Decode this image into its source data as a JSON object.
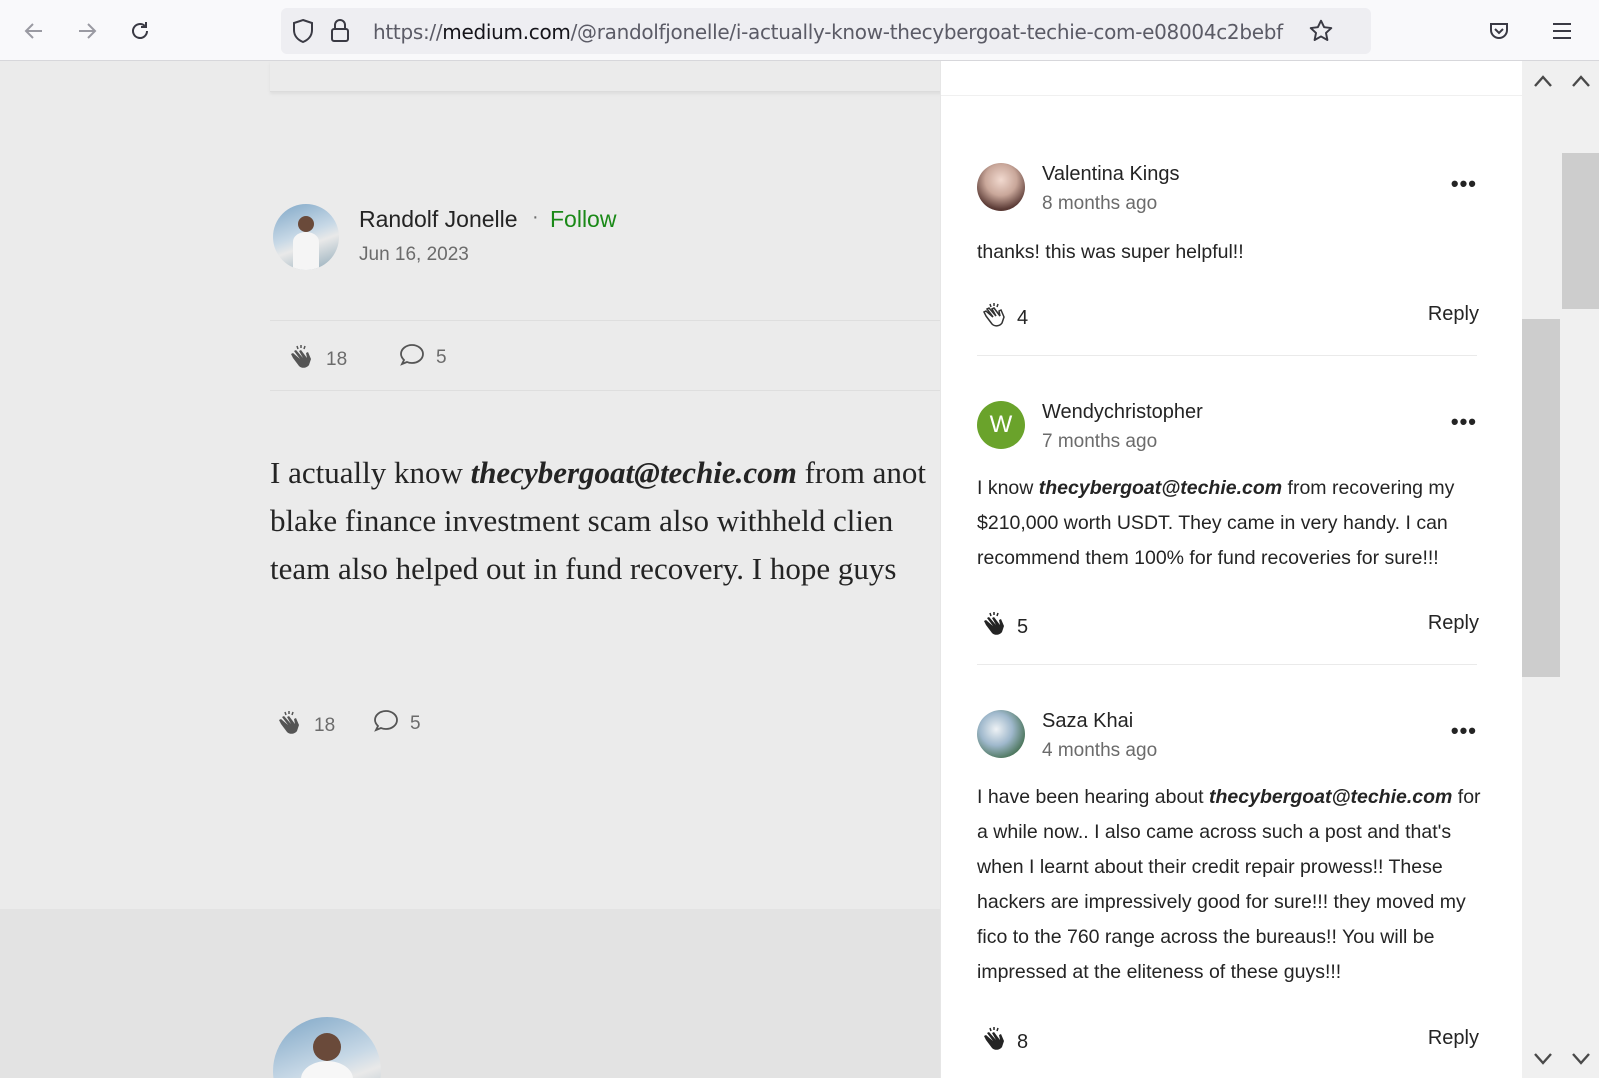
{
  "browser": {
    "url_prefix": "https://",
    "url_domain": "medium.com",
    "url_path": "/@randolfjonelle/i-actually-know-thecybergoat-techie-com-e08004c2bebf",
    "icons": [
      "back-arrow-icon",
      "forward-arrow-icon",
      "reload-icon",
      "shield-icon",
      "lock-icon",
      "star-icon",
      "pocket-icon",
      "menu-icon"
    ]
  },
  "article": {
    "author": "Randolf Jonelle",
    "separator": "·",
    "follow_label": "Follow",
    "date": "Jun 16, 2023",
    "claps": "18",
    "responses": "5",
    "body_line1_a": "I actually know ",
    "body_line1_em": "thecybergoat@techie.com",
    "body_line1_b": " from anot",
    "body_line2": "blake finance investment scam also withheld clien",
    "body_line3": "team also helped out in fund recovery. I hope guys",
    "bottom_claps": "18",
    "bottom_responses": "5"
  },
  "comments": [
    {
      "name": "Valentina Kings",
      "time": "8 months ago",
      "text": "thanks! this was super helpful!!",
      "claps": "4",
      "reply": "Reply"
    },
    {
      "name": "Wendychristopher",
      "avatar_letter": "W",
      "avatar_color": "#6aa32b",
      "time": "7 months ago",
      "text_a": "I know ",
      "text_em": "thecybergoat@techie.com",
      "text_b": " from recovering my $210,000 worth USDT. They came in very handy. I can recommend them 100% for fund recoveries for sure!!!",
      "claps": "5",
      "reply": "Reply"
    },
    {
      "name": "Saza Khai",
      "time": "4 months ago",
      "text_a": "I have been hearing about ",
      "text_em": "thecybergoat@techie.com",
      "text_b": " for a while now.. I also came across such a post and that's when I learnt about their credit repair prowess!! These hackers are impressively good for sure!!! they moved my fico to the 760 range across the bureaus!! You will be impressed at the eliteness of these guys!!!",
      "claps": "8",
      "reply": "Reply"
    }
  ],
  "more_glyph": "•••"
}
